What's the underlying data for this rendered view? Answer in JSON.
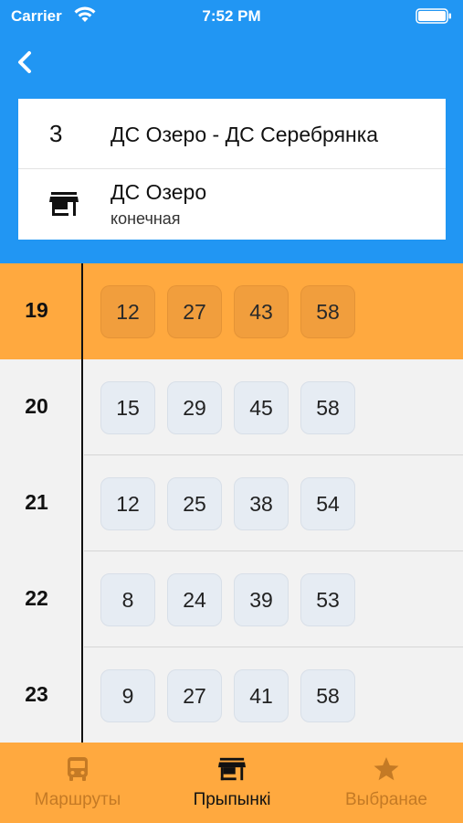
{
  "status_bar": {
    "carrier": "Carrier",
    "time": "7:52 PM",
    "icons": [
      "wifi-icon",
      "battery-icon"
    ]
  },
  "header": {
    "back_icon": "chevron-left-icon",
    "background_color": "#2196f3"
  },
  "route": {
    "number": "3",
    "name": "ДС Озеро - ДС Серебрянка"
  },
  "stop": {
    "icon": "store-icon",
    "name": "ДС Озеро",
    "type": "конечная"
  },
  "schedule": {
    "highlight_color": "#ffa93f",
    "rows": [
      {
        "hour": "19",
        "current": true,
        "minutes": [
          "12",
          "27",
          "43",
          "58"
        ]
      },
      {
        "hour": "20",
        "current": false,
        "minutes": [
          "15",
          "29",
          "45",
          "58"
        ]
      },
      {
        "hour": "21",
        "current": false,
        "minutes": [
          "12",
          "25",
          "38",
          "54"
        ]
      },
      {
        "hour": "22",
        "current": false,
        "minutes": [
          "8",
          "24",
          "39",
          "53"
        ]
      },
      {
        "hour": "23",
        "current": false,
        "minutes": [
          "9",
          "27",
          "41",
          "58"
        ]
      }
    ]
  },
  "tabbar": {
    "background_color": "#ffa93f",
    "tabs": [
      {
        "label": "Маршруты",
        "icon": "bus-icon",
        "active": false
      },
      {
        "label": "Прыпынкі",
        "icon": "store-icon",
        "active": true
      },
      {
        "label": "Выбранае",
        "icon": "star-icon",
        "active": false
      }
    ]
  }
}
